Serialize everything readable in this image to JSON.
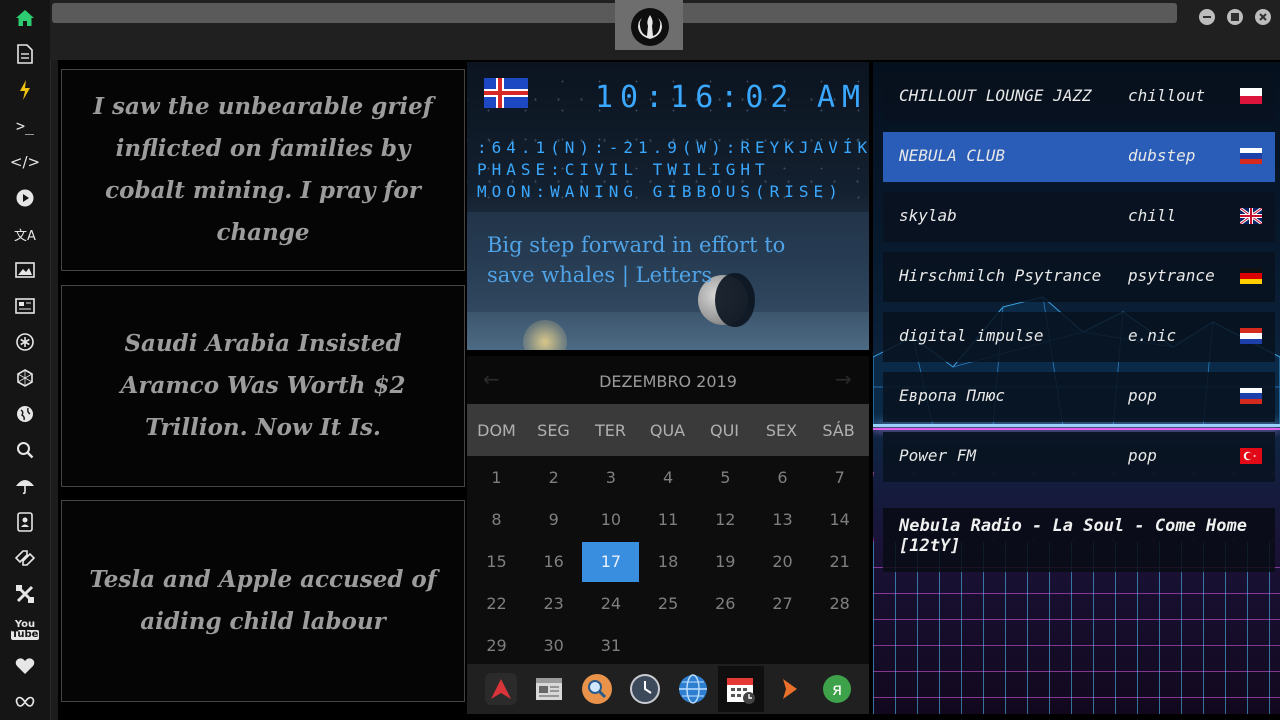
{
  "sidebar": {
    "icons": [
      "home-icon",
      "document-icon",
      "lightning-icon",
      "terminal-icon",
      "code-icon",
      "play-icon",
      "translate-icon",
      "image-icon",
      "news-icon",
      "asterisk-icon",
      "hexagon-icon",
      "globe-icon",
      "search-icon",
      "umbrella-icon",
      "contacts-icon",
      "tag-icon",
      "tools-icon",
      "youtube-icon",
      "heart-icon",
      "infinity-icon"
    ]
  },
  "quotes": [
    "I saw the unbearable grief inflicted on families by cobalt mining. I pray for change",
    "Saudi Arabia Insisted Aramco Was Worth $2 Trillion. Now It Is.",
    "Tesla and Apple accused of aiding child labour"
  ],
  "clock": {
    "time": "10:16:02",
    "ampm": "AM",
    "location": ":64.1(N):-21.9(W):REYKJAVÍK",
    "phase": "PHASE:CIVIL TWILIGHT",
    "moon": "MOON:WANING GIBBOUS(RISE)",
    "headline": "Big step forward in effort to save whales | Letters",
    "accent": "#3aa8ff"
  },
  "calendar": {
    "month": "DEZEMBRO 2019",
    "weekdays": [
      "DOM",
      "SEG",
      "TER",
      "QUA",
      "QUI",
      "SEX",
      "SÁB"
    ],
    "weeks": [
      [
        "1",
        "2",
        "3",
        "4",
        "5",
        "6",
        "7"
      ],
      [
        "8",
        "9",
        "10",
        "11",
        "12",
        "13",
        "14"
      ],
      [
        "15",
        "16",
        "17",
        "18",
        "19",
        "20",
        "21"
      ],
      [
        "22",
        "23",
        "24",
        "25",
        "26",
        "27",
        "28"
      ],
      [
        "29",
        "30",
        "31",
        "",
        "",
        "",
        ""
      ]
    ],
    "today": "17",
    "today_color": "#3a8ee0"
  },
  "dock": {
    "items": [
      "arch-app-icon",
      "calendar-news-icon",
      "magnifier-icon",
      "clock-icon",
      "globe-browser-icon",
      "calendar-app-icon",
      "arrow-app-icon",
      "yandex-icon"
    ]
  },
  "radio": {
    "stations": [
      {
        "name": "CHILLOUT LOUNGE JAZZ",
        "genre": "chillout",
        "flag": "poland"
      },
      {
        "name": "NEBULA CLUB",
        "genre": "dubstep",
        "flag": "russia"
      },
      {
        "name": "skylab",
        "genre": "chill",
        "flag": "uk"
      },
      {
        "name": "Hirschmilch Psytrance",
        "genre": "psytrance",
        "flag": "germany"
      },
      {
        "name": "digital impulse",
        "genre": "e.nic",
        "flag": "croatia"
      },
      {
        "name": "Европа Плюс",
        "genre": "pop",
        "flag": "russia"
      },
      {
        "name": "Power FM",
        "genre": "pop",
        "flag": "turkey"
      }
    ],
    "now_playing": "Nebula Radio - La Soul - Come Home [12tY]",
    "active_color": "#2a5db8"
  }
}
